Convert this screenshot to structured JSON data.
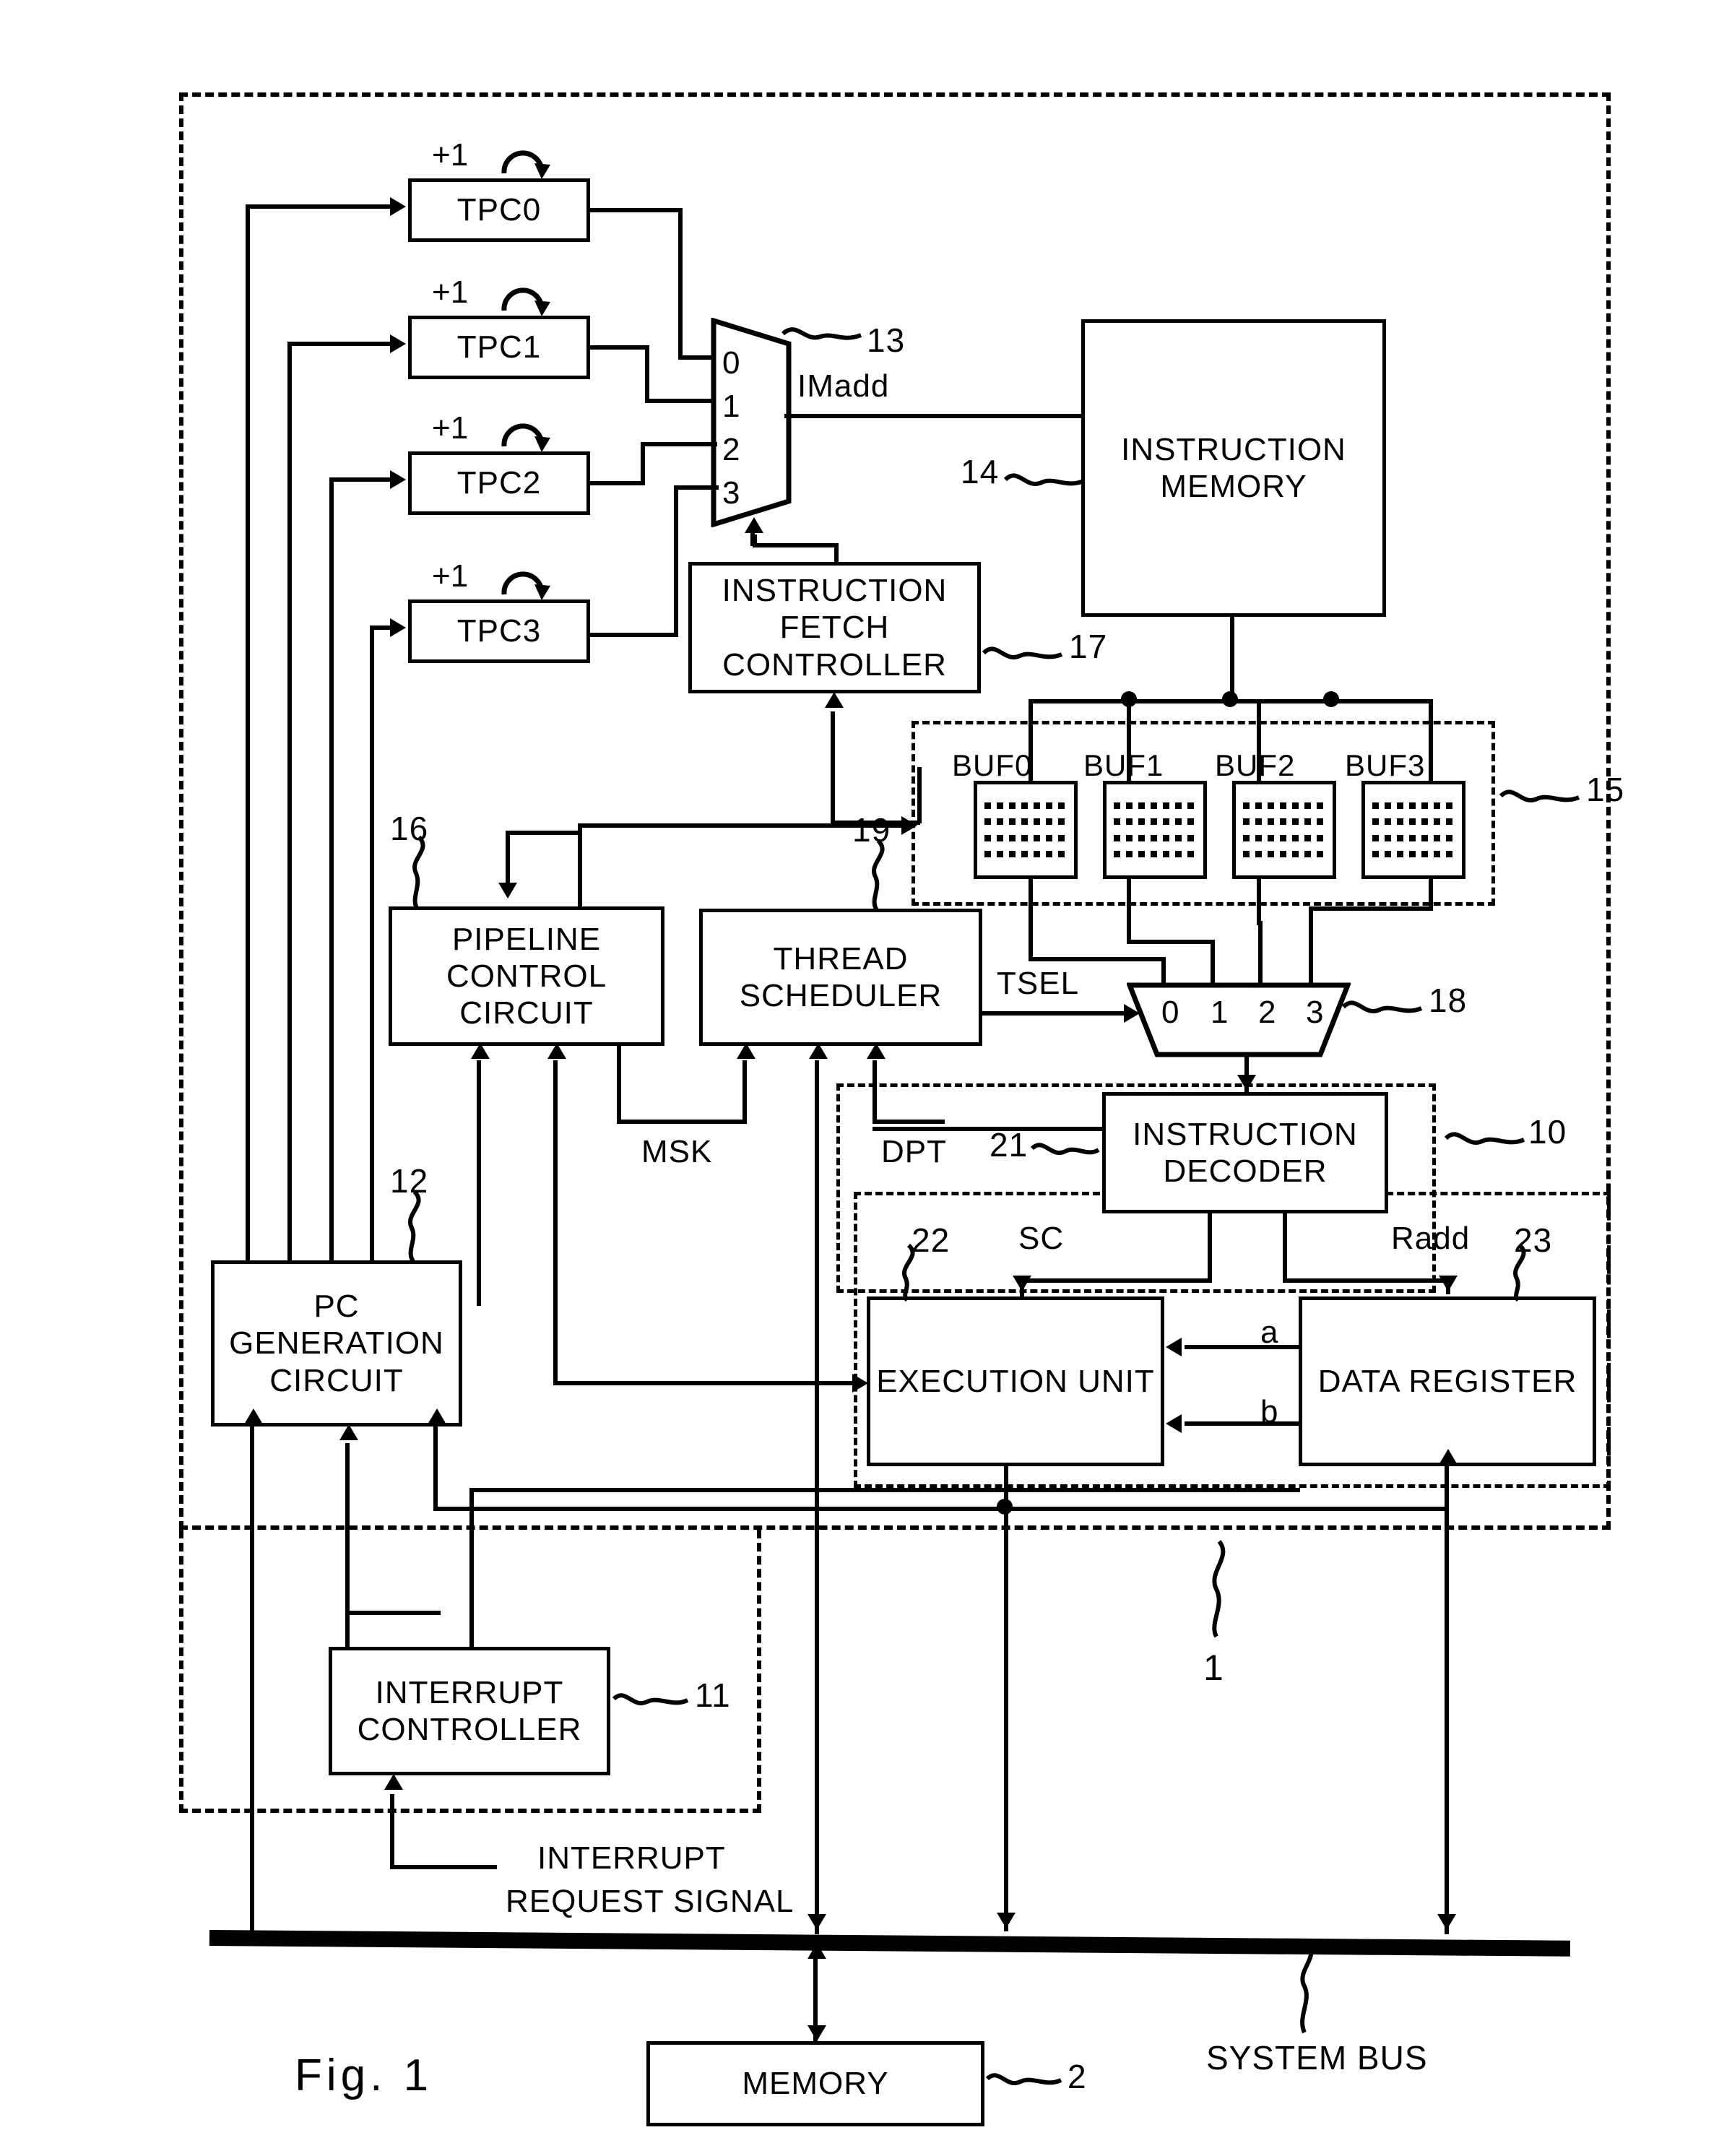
{
  "figure": {
    "title": "Fig. 1",
    "caption_system_bus": "SYSTEM BUS"
  },
  "blocks": {
    "tpc0": {
      "label": "TPC0",
      "increment": "+1"
    },
    "tpc1": {
      "label": "TPC1",
      "increment": "+1"
    },
    "tpc2": {
      "label": "TPC2",
      "increment": "+1"
    },
    "tpc3": {
      "label": "TPC3",
      "increment": "+1"
    },
    "instruction_memory": {
      "line1": "INSTRUCTION",
      "line2": "MEMORY",
      "ref": "14"
    },
    "instruction_fetch_controller": {
      "line1": "INSTRUCTION",
      "line2": "FETCH",
      "line3": "CONTROLLER",
      "ref": "17"
    },
    "pipeline_control_circuit": {
      "line1": "PIPELINE",
      "line2": "CONTROL",
      "line3": "CIRCUIT",
      "ref": "16"
    },
    "thread_scheduler": {
      "line1": "THREAD",
      "line2": "SCHEDULER",
      "ref": "19"
    },
    "instruction_decoder": {
      "line1": "INSTRUCTION",
      "line2": "DECODER",
      "ref": "21"
    },
    "execution_unit": {
      "line1": "EXECUTION UNIT",
      "ref": "22"
    },
    "data_register": {
      "line1": "DATA REGISTER",
      "ref": "23"
    },
    "pc_generation_circuit": {
      "line1": "PC",
      "line2": "GENERATION",
      "line3": "CIRCUIT",
      "ref": "12"
    },
    "interrupt_controller": {
      "line1": "INTERRUPT",
      "line2": "CONTROLLER",
      "ref": "11"
    },
    "memory": {
      "line1": "MEMORY",
      "ref": "2"
    }
  },
  "buffers": {
    "ref": "15",
    "items": [
      {
        "label": "BUF0"
      },
      {
        "label": "BUF1"
      },
      {
        "label": "BUF2"
      },
      {
        "label": "BUF3"
      }
    ]
  },
  "muxes": {
    "address_mux": {
      "ref": "13",
      "inputs": [
        "0",
        "1",
        "2",
        "3"
      ],
      "output_signal": "IMadd"
    },
    "instruction_mux": {
      "ref": "18",
      "inputs": [
        "0",
        "1",
        "2",
        "3"
      ],
      "select_signal": "TSEL"
    }
  },
  "signals": {
    "imadd": "IMadd",
    "tsel": "TSEL",
    "msk": "MSK",
    "dpt": "DPT",
    "sc": "SC",
    "radd": "Radd",
    "operand_a": "a",
    "operand_b": "b",
    "interrupt_request": {
      "line1": "INTERRUPT",
      "line2": "REQUEST SIGNAL"
    }
  },
  "reference_numerals": {
    "processor_core": "1",
    "memory": "2",
    "decode_exec_group": "10",
    "interrupt_controller": "11",
    "pc_generation_circuit": "12",
    "address_mux": "13",
    "instruction_memory": "14",
    "buffer_group": "15",
    "pipeline_control_circuit": "16",
    "instruction_fetch_controller": "17",
    "instruction_mux": "18",
    "thread_scheduler": "19",
    "instruction_decoder": "21",
    "execution_unit": "22",
    "data_register": "23"
  },
  "colors": {
    "ink": "#000000",
    "paper": "#ffffff"
  }
}
